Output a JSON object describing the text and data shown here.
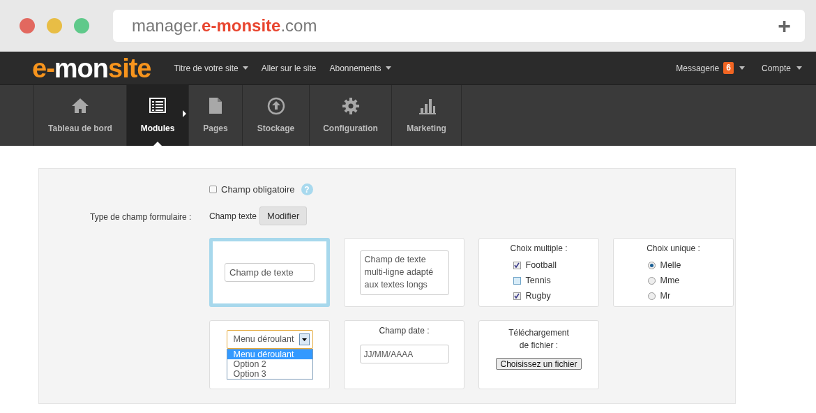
{
  "browser": {
    "url": [
      {
        "text": "manager.",
        "accent": false
      },
      {
        "text": "e-monsite",
        "accent": true
      },
      {
        "text": ".com",
        "accent": false
      }
    ],
    "new_tab": "+"
  },
  "topbar": {
    "logo": [
      {
        "text": "e-",
        "accent": true
      },
      {
        "text": "mon",
        "accent": false
      },
      {
        "text": "site",
        "accent": true
      }
    ],
    "menu": [
      {
        "label": "Titre de votre site",
        "dropdown": true
      },
      {
        "label": "Aller sur le site",
        "dropdown": false
      },
      {
        "label": "Abonnements",
        "dropdown": true
      }
    ],
    "right": [
      {
        "label": "Messagerie",
        "badge": "6",
        "dropdown": true
      },
      {
        "label": "Compte",
        "dropdown": true
      }
    ]
  },
  "modules": [
    {
      "label": "Tableau de bord",
      "selected": false
    },
    {
      "label": "Modules",
      "selected": true
    },
    {
      "label": "Pages",
      "selected": false
    },
    {
      "label": "Stockage",
      "selected": false
    },
    {
      "label": "Configuration",
      "selected": false
    },
    {
      "label": "Marketing",
      "selected": false
    }
  ],
  "form": {
    "required": {
      "label": "Champ obligatoire",
      "checked": false,
      "help": "?"
    },
    "field_type": {
      "label": "Type de champ formulaire :",
      "value": "Champ texte",
      "button": "Modifier"
    },
    "cards": [
      {
        "kind": "text",
        "selected": true,
        "value": "Champ de texte"
      },
      {
        "kind": "textarea",
        "selected": false,
        "value": "Champ de texte multi-ligne adapté aux textes longs"
      },
      {
        "kind": "checkboxes",
        "selected": false,
        "title": "Choix multiple :",
        "options": [
          {
            "label": "Football",
            "checked": true
          },
          {
            "label": "Tennis",
            "checked": false
          },
          {
            "label": "Rugby",
            "checked": true
          }
        ]
      },
      {
        "kind": "radios",
        "selected": false,
        "title": "Choix unique :",
        "options": [
          {
            "label": "Melle",
            "checked": true
          },
          {
            "label": "Mme",
            "checked": false
          },
          {
            "label": "Mr",
            "checked": false
          }
        ]
      },
      {
        "kind": "select",
        "selected": false,
        "value": "Menu déroulant",
        "options": [
          {
            "label": "Menu déroulant",
            "selected": true
          },
          {
            "label": "Option 2",
            "selected": false
          },
          {
            "label": "Option 3",
            "selected": false
          }
        ]
      },
      {
        "kind": "date",
        "selected": false,
        "title": "Champ date :",
        "placeholder": "JJ/MM/AAAA"
      },
      {
        "kind": "file",
        "selected": false,
        "title": "Téléchargement de fichier :",
        "button": "Choisissez un fichier"
      }
    ]
  }
}
